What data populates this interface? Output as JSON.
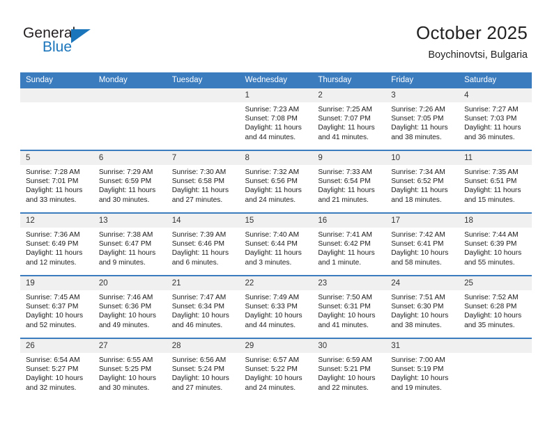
{
  "brand": {
    "name_top": "General",
    "name_bottom": "Blue",
    "accent_color": "#1b75bb",
    "triangle_icon": "triangle-icon"
  },
  "header": {
    "title": "October 2025",
    "subtitle": "Boychinovtsi, Bulgaria"
  },
  "colors": {
    "header_blue": "#3b7cbf",
    "daynum_gray": "#f0f0f0",
    "text": "#1a1a1a"
  },
  "weekdays": [
    "Sunday",
    "Monday",
    "Tuesday",
    "Wednesday",
    "Thursday",
    "Friday",
    "Saturday"
  ],
  "labels": {
    "sunrise_prefix": "Sunrise:",
    "sunset_prefix": "Sunset:",
    "daylight_prefix": "Daylight:"
  },
  "weeks": [
    [
      {
        "day": "",
        "empty": true,
        "sunrise": "",
        "sunset": "",
        "daylight": ""
      },
      {
        "day": "",
        "empty": true,
        "sunrise": "",
        "sunset": "",
        "daylight": ""
      },
      {
        "day": "",
        "empty": true,
        "sunrise": "",
        "sunset": "",
        "daylight": ""
      },
      {
        "day": "1",
        "sunrise": "Sunrise: 7:23 AM",
        "sunset": "Sunset: 7:08 PM",
        "daylight": "Daylight: 11 hours and 44 minutes."
      },
      {
        "day": "2",
        "sunrise": "Sunrise: 7:25 AM",
        "sunset": "Sunset: 7:07 PM",
        "daylight": "Daylight: 11 hours and 41 minutes."
      },
      {
        "day": "3",
        "sunrise": "Sunrise: 7:26 AM",
        "sunset": "Sunset: 7:05 PM",
        "daylight": "Daylight: 11 hours and 38 minutes."
      },
      {
        "day": "4",
        "sunrise": "Sunrise: 7:27 AM",
        "sunset": "Sunset: 7:03 PM",
        "daylight": "Daylight: 11 hours and 36 minutes."
      }
    ],
    [
      {
        "day": "5",
        "sunrise": "Sunrise: 7:28 AM",
        "sunset": "Sunset: 7:01 PM",
        "daylight": "Daylight: 11 hours and 33 minutes."
      },
      {
        "day": "6",
        "sunrise": "Sunrise: 7:29 AM",
        "sunset": "Sunset: 6:59 PM",
        "daylight": "Daylight: 11 hours and 30 minutes."
      },
      {
        "day": "7",
        "sunrise": "Sunrise: 7:30 AM",
        "sunset": "Sunset: 6:58 PM",
        "daylight": "Daylight: 11 hours and 27 minutes."
      },
      {
        "day": "8",
        "sunrise": "Sunrise: 7:32 AM",
        "sunset": "Sunset: 6:56 PM",
        "daylight": "Daylight: 11 hours and 24 minutes."
      },
      {
        "day": "9",
        "sunrise": "Sunrise: 7:33 AM",
        "sunset": "Sunset: 6:54 PM",
        "daylight": "Daylight: 11 hours and 21 minutes."
      },
      {
        "day": "10",
        "sunrise": "Sunrise: 7:34 AM",
        "sunset": "Sunset: 6:52 PM",
        "daylight": "Daylight: 11 hours and 18 minutes."
      },
      {
        "day": "11",
        "sunrise": "Sunrise: 7:35 AM",
        "sunset": "Sunset: 6:51 PM",
        "daylight": "Daylight: 11 hours and 15 minutes."
      }
    ],
    [
      {
        "day": "12",
        "sunrise": "Sunrise: 7:36 AM",
        "sunset": "Sunset: 6:49 PM",
        "daylight": "Daylight: 11 hours and 12 minutes."
      },
      {
        "day": "13",
        "sunrise": "Sunrise: 7:38 AM",
        "sunset": "Sunset: 6:47 PM",
        "daylight": "Daylight: 11 hours and 9 minutes."
      },
      {
        "day": "14",
        "sunrise": "Sunrise: 7:39 AM",
        "sunset": "Sunset: 6:46 PM",
        "daylight": "Daylight: 11 hours and 6 minutes."
      },
      {
        "day": "15",
        "sunrise": "Sunrise: 7:40 AM",
        "sunset": "Sunset: 6:44 PM",
        "daylight": "Daylight: 11 hours and 3 minutes."
      },
      {
        "day": "16",
        "sunrise": "Sunrise: 7:41 AM",
        "sunset": "Sunset: 6:42 PM",
        "daylight": "Daylight: 11 hours and 1 minute."
      },
      {
        "day": "17",
        "sunrise": "Sunrise: 7:42 AM",
        "sunset": "Sunset: 6:41 PM",
        "daylight": "Daylight: 10 hours and 58 minutes."
      },
      {
        "day": "18",
        "sunrise": "Sunrise: 7:44 AM",
        "sunset": "Sunset: 6:39 PM",
        "daylight": "Daylight: 10 hours and 55 minutes."
      }
    ],
    [
      {
        "day": "19",
        "sunrise": "Sunrise: 7:45 AM",
        "sunset": "Sunset: 6:37 PM",
        "daylight": "Daylight: 10 hours and 52 minutes."
      },
      {
        "day": "20",
        "sunrise": "Sunrise: 7:46 AM",
        "sunset": "Sunset: 6:36 PM",
        "daylight": "Daylight: 10 hours and 49 minutes."
      },
      {
        "day": "21",
        "sunrise": "Sunrise: 7:47 AM",
        "sunset": "Sunset: 6:34 PM",
        "daylight": "Daylight: 10 hours and 46 minutes."
      },
      {
        "day": "22",
        "sunrise": "Sunrise: 7:49 AM",
        "sunset": "Sunset: 6:33 PM",
        "daylight": "Daylight: 10 hours and 44 minutes."
      },
      {
        "day": "23",
        "sunrise": "Sunrise: 7:50 AM",
        "sunset": "Sunset: 6:31 PM",
        "daylight": "Daylight: 10 hours and 41 minutes."
      },
      {
        "day": "24",
        "sunrise": "Sunrise: 7:51 AM",
        "sunset": "Sunset: 6:30 PM",
        "daylight": "Daylight: 10 hours and 38 minutes."
      },
      {
        "day": "25",
        "sunrise": "Sunrise: 7:52 AM",
        "sunset": "Sunset: 6:28 PM",
        "daylight": "Daylight: 10 hours and 35 minutes."
      }
    ],
    [
      {
        "day": "26",
        "sunrise": "Sunrise: 6:54 AM",
        "sunset": "Sunset: 5:27 PM",
        "daylight": "Daylight: 10 hours and 32 minutes."
      },
      {
        "day": "27",
        "sunrise": "Sunrise: 6:55 AM",
        "sunset": "Sunset: 5:25 PM",
        "daylight": "Daylight: 10 hours and 30 minutes."
      },
      {
        "day": "28",
        "sunrise": "Sunrise: 6:56 AM",
        "sunset": "Sunset: 5:24 PM",
        "daylight": "Daylight: 10 hours and 27 minutes."
      },
      {
        "day": "29",
        "sunrise": "Sunrise: 6:57 AM",
        "sunset": "Sunset: 5:22 PM",
        "daylight": "Daylight: 10 hours and 24 minutes."
      },
      {
        "day": "30",
        "sunrise": "Sunrise: 6:59 AM",
        "sunset": "Sunset: 5:21 PM",
        "daylight": "Daylight: 10 hours and 22 minutes."
      },
      {
        "day": "31",
        "sunrise": "Sunrise: 7:00 AM",
        "sunset": "Sunset: 5:19 PM",
        "daylight": "Daylight: 10 hours and 19 minutes."
      },
      {
        "day": "",
        "empty": true,
        "sunrise": "",
        "sunset": "",
        "daylight": ""
      }
    ]
  ]
}
